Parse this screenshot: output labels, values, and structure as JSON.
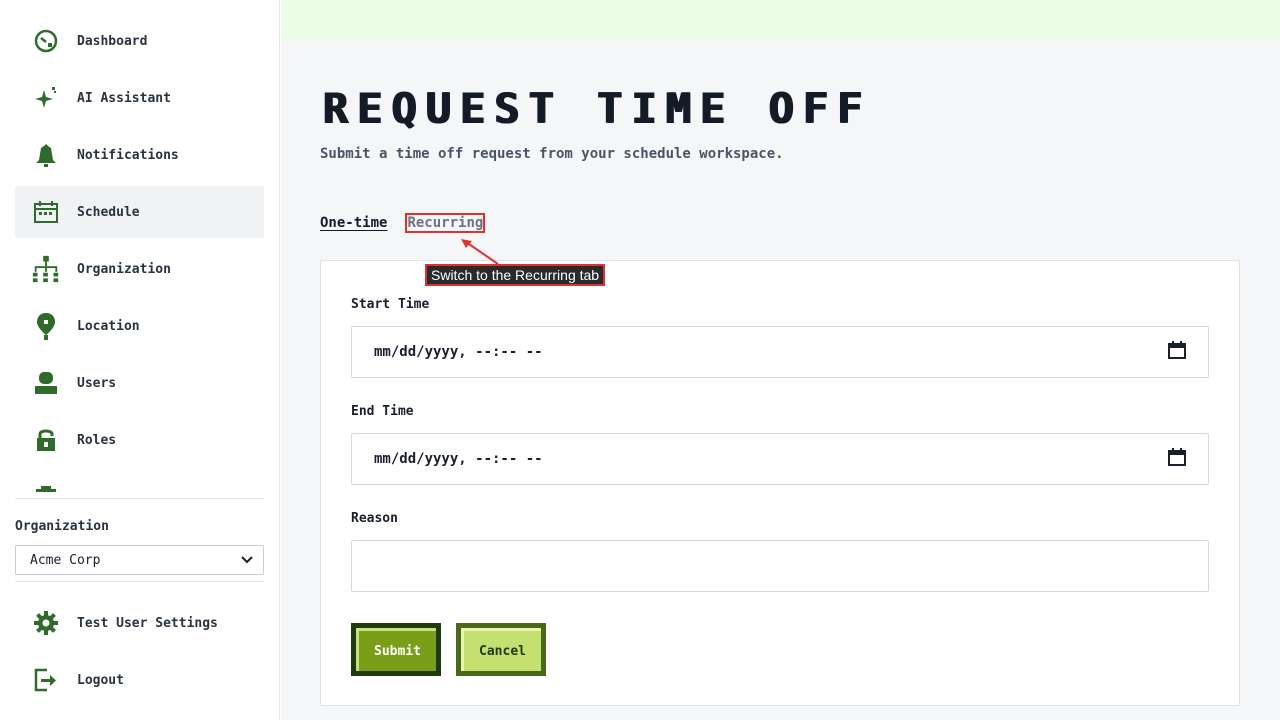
{
  "sidebar": {
    "items": [
      {
        "label": "Dashboard",
        "icon": "dashboard-icon"
      },
      {
        "label": "AI Assistant",
        "icon": "sparkle-icon"
      },
      {
        "label": "Notifications",
        "icon": "bell-icon"
      },
      {
        "label": "Schedule",
        "icon": "calendar-icon",
        "active": true
      },
      {
        "label": "Organization",
        "icon": "org-chart-icon"
      },
      {
        "label": "Location",
        "icon": "location-pin-icon"
      },
      {
        "label": "Users",
        "icon": "user-icon"
      },
      {
        "label": "Roles",
        "icon": "lock-icon"
      }
    ],
    "org_label": "Organization",
    "org_selected": "Acme Corp",
    "bottom_items": [
      {
        "label": "Test User Settings",
        "icon": "gear-icon"
      },
      {
        "label": "Logout",
        "icon": "logout-icon"
      }
    ]
  },
  "main": {
    "title": "REQUEST TIME OFF",
    "subtitle": "Submit a time off request from your schedule workspace.",
    "tabs": [
      {
        "label": "One-time",
        "active": true
      },
      {
        "label": "Recurring",
        "active": false
      }
    ],
    "annotation": "Switch to the Recurring tab",
    "form": {
      "start_label": "Start Time",
      "start_value": "mm/dd/yyyy, --:-- --",
      "end_label": "End Time",
      "end_value": "mm/dd/yyyy, --:-- --",
      "reason_label": "Reason",
      "reason_value": "",
      "submit_label": "Submit",
      "cancel_label": "Cancel"
    }
  },
  "colors": {
    "icon_green": "#2f6b2a",
    "topbar": "#ebfde7",
    "highlight": "#e03030"
  }
}
